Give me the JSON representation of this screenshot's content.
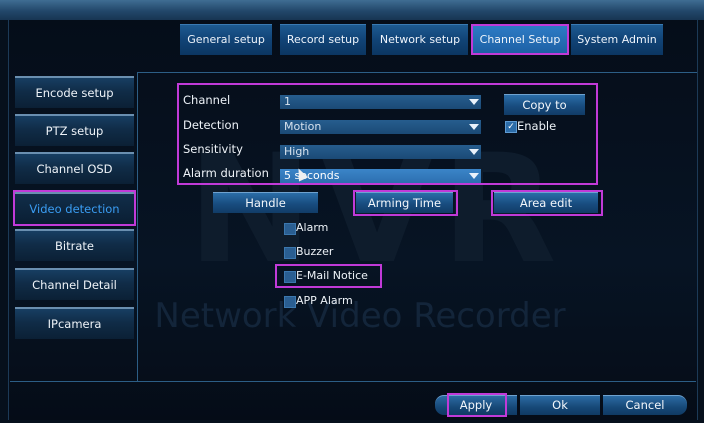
{
  "tabs": [
    "General setup",
    "Record setup",
    "Network setup",
    "Channel Setup",
    "System Admin"
  ],
  "sidebar": [
    "Encode setup",
    "PTZ setup",
    "Channel OSD",
    "Video detection",
    "Bitrate",
    "Channel Detail",
    "IPcamera"
  ],
  "form": {
    "channel_label": "Channel",
    "channel_value": "1",
    "detection_label": "Detection",
    "detection_value": "Motion",
    "sensitivity_label": "Sensitivity",
    "sensitivity_value": "High",
    "alarm_label": "Alarm duration",
    "alarm_value": "5 seconds"
  },
  "copy_to": "Copy to",
  "enable_label": "Enable",
  "buttons": {
    "handle": "Handle",
    "arming": "Arming Time",
    "area": "Area edit"
  },
  "checks": [
    "Alarm",
    "Buzzer",
    "E-Mail Notice",
    "APP Alarm"
  ],
  "watermark": "Network Video Recorder",
  "watermark_logo": "NVR",
  "footer": {
    "apply": "Apply",
    "ok": "Ok",
    "cancel": "Cancel"
  }
}
